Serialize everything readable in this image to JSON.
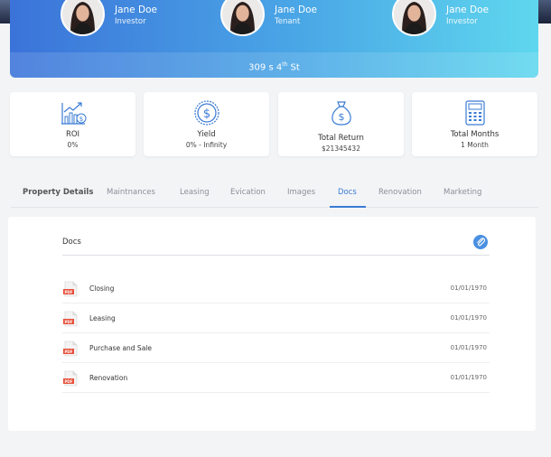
{
  "people": [
    {
      "name": "Jane Doe",
      "role": "Investor"
    },
    {
      "name": "Jane Doe",
      "role": "Tenant"
    },
    {
      "name": "Jane Doe",
      "role": "Investor"
    }
  ],
  "property": {
    "address_main": "309 s 4",
    "address_sup": "th",
    "address_rest": " St"
  },
  "stats": [
    {
      "icon": "chart-growth-icon",
      "label": "ROI",
      "value": "0%"
    },
    {
      "icon": "dollar-coin-icon",
      "label": "Yield",
      "value": "0% - Infinity"
    },
    {
      "icon": "money-bag-icon",
      "label": "Total Return",
      "value": "$21345432"
    },
    {
      "icon": "calculator-icon",
      "label": "Total Months",
      "value": "1 Month"
    }
  ],
  "tabs": [
    "Property Details",
    "Maintnances",
    "Leasing",
    "Evication",
    "Images",
    "Docs",
    "Renovation",
    "Marketing"
  ],
  "active_tab": "Docs",
  "docs": {
    "title": "Docs",
    "items": [
      {
        "icon_text": "PDF",
        "name": "Closing",
        "date": "01/01/1970"
      },
      {
        "icon_text": "PDF",
        "name": "Leasing",
        "date": "01/01/1970"
      },
      {
        "icon_text": "PDF",
        "name": "Purchase and Sale",
        "date": "01/01/1970"
      },
      {
        "icon_text": "PDF",
        "name": "Renovation",
        "date": "01/01/1970"
      }
    ]
  },
  "colors": {
    "accent": "#3a7bd5",
    "banner_start": "#3b73d9",
    "banner_end": "#5fd7ee",
    "pdf_red": "#e8503a"
  }
}
